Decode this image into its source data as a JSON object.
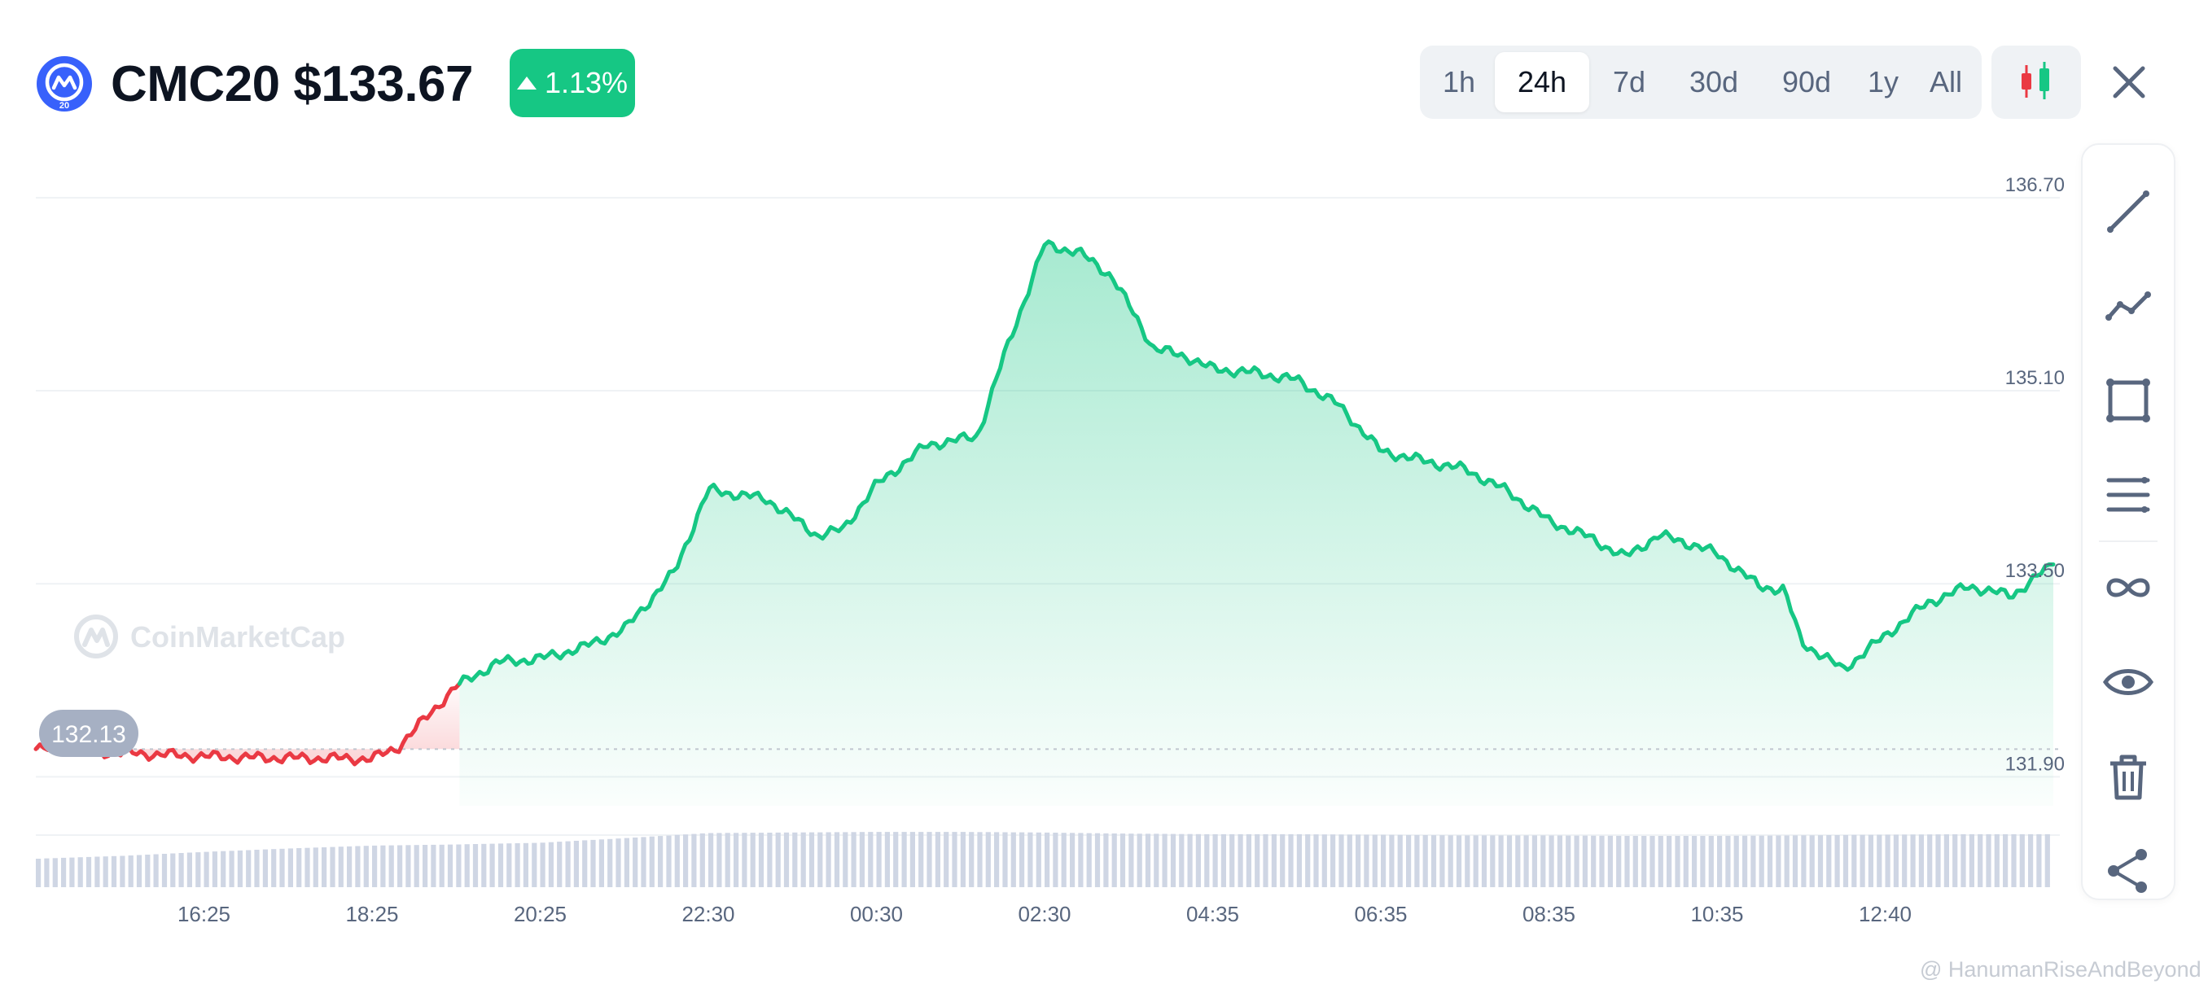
{
  "header": {
    "symbol": "CMC20",
    "price": "$133.67",
    "change": "1.13%",
    "logo_badge": "20"
  },
  "timeframes": [
    "1h",
    "24h",
    "7d",
    "30d",
    "90d",
    "1y",
    "All"
  ],
  "active_timeframe": "24h",
  "toolbar": {
    "tools": [
      "trend-line-icon",
      "polyline-icon",
      "rectangle-icon",
      "parallel-lines-icon",
      "infinity-icon",
      "eye-icon",
      "trash-icon",
      "share-icon"
    ]
  },
  "watermark": {
    "chart": "CoinMarketCap",
    "credit": "@ HanumanRiseAndBeyond"
  },
  "colors": {
    "up": "#16c784",
    "down": "#ea3943",
    "accent": "#3861fb",
    "grid": "#eff2f5",
    "axis_text": "#58667e"
  },
  "chart_data": {
    "type": "area",
    "y_ticks": [
      "136.70",
      "135.10",
      "133.50",
      "131.90"
    ],
    "x_ticks": [
      "16:25",
      "18:25",
      "20:25",
      "22:30",
      "00:30",
      "02:30",
      "04:35",
      "06:35",
      "08:35",
      "10:35",
      "12:40"
    ],
    "ylim": [
      131.66,
      136.8
    ],
    "baseline": 132.13,
    "baseline_label": "132.13",
    "x_end": 24,
    "series": [
      {
        "x": [
          0,
          2,
          2.5,
          4,
          4.3,
          5,
          5.5,
          6,
          6.5,
          7,
          7.6,
          8,
          8.7,
          9.3,
          9.6,
          10,
          10.6,
          11.2,
          11.5,
          12,
          12.4,
          12.8,
          13.3,
          13.7,
          14,
          14.5,
          15,
          15.5,
          16,
          16.5,
          17,
          17.5,
          18,
          18.5,
          18.9,
          19.3,
          19.6,
          20,
          20.5,
          20.8,
          21,
          21.5,
          22,
          22.5,
          23,
          23.5,
          24
        ],
        "y": [
          132.13,
          132.07,
          132.06,
          132.05,
          132.14,
          132.65,
          132.85,
          132.88,
          132.97,
          133.12,
          133.6,
          134.28,
          134.2,
          133.9,
          133.95,
          134.32,
          134.65,
          134.72,
          135.35,
          136.31,
          136.25,
          136.05,
          135.45,
          135.38,
          135.28,
          135.25,
          135.19,
          134.98,
          134.6,
          134.52,
          134.45,
          134.27,
          134.02,
          133.88,
          133.72,
          133.9,
          133.85,
          133.75,
          133.48,
          133.45,
          133.02,
          132.79,
          133.07,
          133.34,
          133.48,
          133.4,
          133.66
        ]
      }
    ],
    "volume": {
      "values": [
        0.5,
        0.55,
        0.62,
        0.68,
        0.73,
        0.75,
        0.78,
        0.86,
        0.95,
        0.96,
        0.97,
        0.97,
        0.96,
        0.94,
        0.93,
        0.93,
        0.92,
        0.91,
        0.91,
        0.9,
        0.9,
        0.91,
        0.92,
        0.93,
        0.93
      ]
    }
  }
}
